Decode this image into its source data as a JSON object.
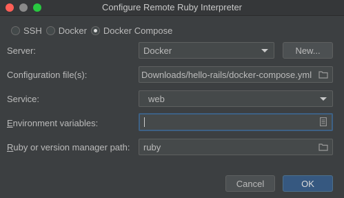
{
  "window": {
    "title": "Configure Remote Ruby Interpreter"
  },
  "connection_types": [
    {
      "label": "SSH",
      "selected": false
    },
    {
      "label": "Docker",
      "selected": false
    },
    {
      "label": "Docker Compose",
      "selected": true
    }
  ],
  "form": {
    "server": {
      "label": "Server:",
      "value": "Docker",
      "new_button": "New..."
    },
    "config_files": {
      "label": "Configuration file(s):",
      "value": "Downloads/hello-rails/docker-compose.yml"
    },
    "service": {
      "label": "Service:",
      "value": "web"
    },
    "env_vars": {
      "label_mnemonic": "E",
      "label_rest": "nvironment variables:",
      "value": ""
    },
    "ruby_path": {
      "label_mnemonic": "R",
      "label_rest": "uby or version manager path:",
      "value": "ruby"
    }
  },
  "buttons": {
    "cancel": "Cancel",
    "ok": "OK"
  }
}
